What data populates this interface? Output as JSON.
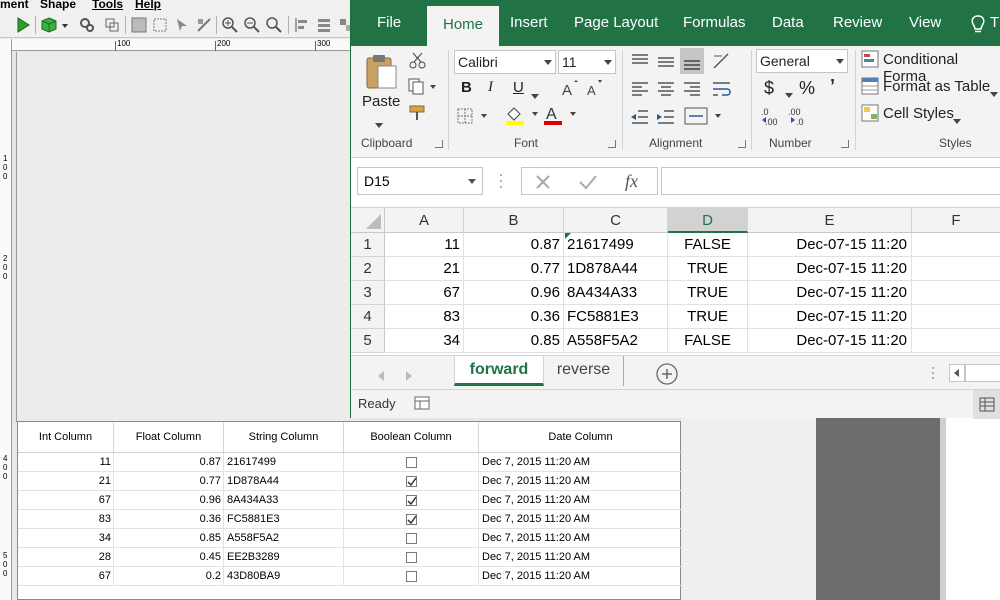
{
  "bg_menu": [
    "ment",
    "Shape",
    "Tools",
    "Help"
  ],
  "bg_ruler_top": [
    "100",
    "200",
    "300"
  ],
  "bg_ruler_left": [
    "1",
    "0",
    "0",
    "2",
    "0",
    "0",
    "4",
    "0",
    "0",
    "5",
    "0",
    "0"
  ],
  "excel": {
    "tabs": [
      "File",
      "Home",
      "Insert",
      "Page Layout",
      "Formulas",
      "Data",
      "Review",
      "View"
    ],
    "tell_me_icon": "lightbulb-icon",
    "tell_me_text": "T",
    "clipboard": {
      "paste_label": "Paste",
      "group_label": "Clipboard"
    },
    "font": {
      "name": "Calibri",
      "size": "11",
      "group_label": "Font",
      "bold": "B",
      "italic": "I",
      "underline": "U",
      "font_color": "#e00000",
      "highlight_color": "#ffff00"
    },
    "alignment": {
      "group_label": "Alignment"
    },
    "number": {
      "format": "General",
      "group_label": "Number",
      "currency": "$",
      "percent": "%",
      "comma": "’"
    },
    "styles": {
      "conditional": "Conditional Forma",
      "format_table": "Format as Table",
      "cell_styles": "Cell Styles",
      "group_label": "Styles"
    },
    "name_box": "D15",
    "formula_value": "",
    "columns": [
      "A",
      "B",
      "C",
      "D",
      "E",
      "F"
    ],
    "selected_column": "D",
    "rows": [
      {
        "n": "1",
        "a": "11",
        "b": "0.87",
        "c": "21617499",
        "d": "FALSE",
        "e": "Dec-07-15 11:20"
      },
      {
        "n": "2",
        "a": "21",
        "b": "0.77",
        "c": "1D878A44",
        "d": "TRUE",
        "e": "Dec-07-15 11:20"
      },
      {
        "n": "3",
        "a": "67",
        "b": "0.96",
        "c": "8A434A33",
        "d": "TRUE",
        "e": "Dec-07-15 11:20"
      },
      {
        "n": "4",
        "a": "83",
        "b": "0.36",
        "c": "FC5881E3",
        "d": "TRUE",
        "e": "Dec-07-15 11:20"
      },
      {
        "n": "5",
        "a": "34",
        "b": "0.85",
        "c": "A558F5A2",
        "d": "FALSE",
        "e": "Dec-07-15 11:20"
      }
    ],
    "sheets": [
      "forward",
      "reverse"
    ],
    "active_sheet": "forward",
    "status": "Ready",
    "accent": "#217346"
  },
  "grid": {
    "headers": [
      "Int Column",
      "Float Column",
      "String Column",
      "Boolean Column",
      "Date Column"
    ],
    "rows": [
      {
        "int": "11",
        "float": "0.87",
        "str": "21617499",
        "bool": false,
        "date": "Dec 7, 2015 11:20 AM"
      },
      {
        "int": "21",
        "float": "0.77",
        "str": "1D878A44",
        "bool": true,
        "date": "Dec 7, 2015 11:20 AM"
      },
      {
        "int": "67",
        "float": "0.96",
        "str": "8A434A33",
        "bool": true,
        "date": "Dec 7, 2015 11:20 AM"
      },
      {
        "int": "83",
        "float": "0.36",
        "str": "FC5881E3",
        "bool": true,
        "date": "Dec 7, 2015 11:20 AM"
      },
      {
        "int": "34",
        "float": "0.85",
        "str": "A558F5A2",
        "bool": false,
        "date": "Dec 7, 2015 11:20 AM"
      },
      {
        "int": "28",
        "float": "0.45",
        "str": "EE2B3289",
        "bool": false,
        "date": "Dec 7, 2015 11:20 AM"
      },
      {
        "int": "67",
        "float": "0.2",
        "str": "43D80BA9",
        "bool": false,
        "date": "Dec 7, 2015 11:20 AM"
      }
    ]
  }
}
